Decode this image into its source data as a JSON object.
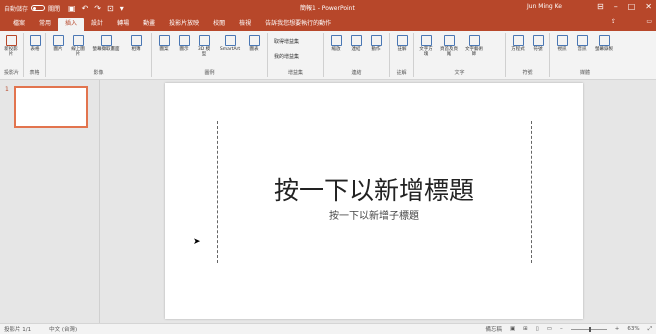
{
  "titlebar": {
    "autosave_label": "自動儲存",
    "autosave_state": "關閉",
    "doc_title": "簡報1 - PowerPoint",
    "user": "Jun Ming Ke",
    "qat": [
      "save-icon",
      "undo-icon",
      "redo-icon",
      "present-icon",
      "customize-icon"
    ]
  },
  "tabs": {
    "items": [
      "檔案",
      "常用",
      "插入",
      "設計",
      "轉場",
      "動畫",
      "投影片放映",
      "校閱",
      "檢視",
      "告訴我您想要執行的動作"
    ],
    "active": "插入"
  },
  "ribbon": {
    "groups": [
      "投影片",
      "表格",
      "影像",
      "圖例",
      "增益集",
      "連結",
      "註解",
      "文字",
      "符號",
      "媒體"
    ],
    "buttons": [
      "新投影片",
      "表格",
      "圖片",
      "線上圖片",
      "螢幕擷取畫面",
      "相簿",
      "圖案",
      "圖示",
      "3D 模型",
      "SmartArt",
      "圖表",
      "取得增益集",
      "我的增益集",
      "縮放",
      "連結",
      "動作",
      "註解",
      "文字方塊",
      "頁首及頁尾",
      "文字藝術師",
      "方程式",
      "符號",
      "視訊",
      "音訊",
      "螢幕錄製"
    ]
  },
  "thumbs": {
    "number": "1"
  },
  "slide": {
    "title": "按一下以新增標題",
    "subtitle": "按一下以新增子標題"
  },
  "statusbar": {
    "slide_pos": "投影片 1/1",
    "language": "中文 (台灣)",
    "notes": "備忘稿",
    "zoom": "63%"
  }
}
